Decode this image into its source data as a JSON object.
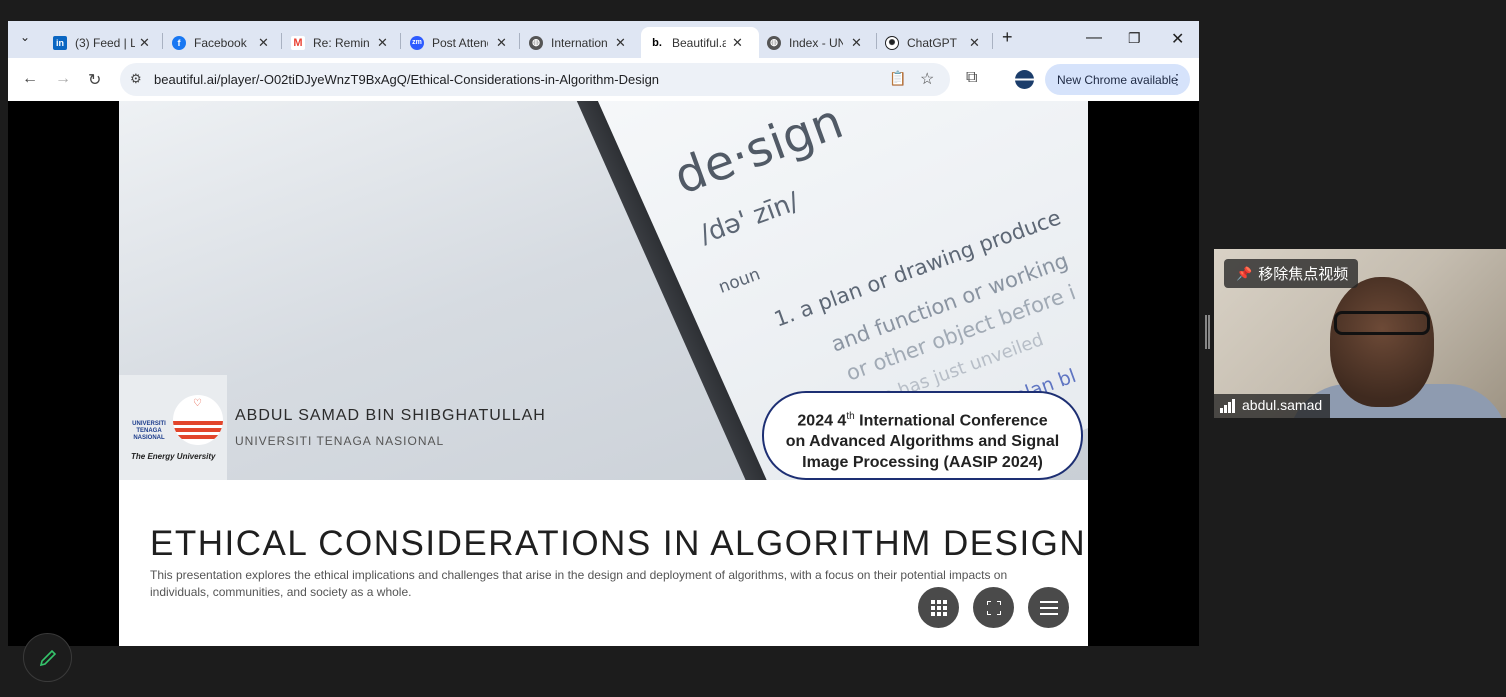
{
  "browser": {
    "tabs": [
      {
        "title": "(3) Feed | L",
        "icon": "linkedin-icon",
        "color": "#0a66c2"
      },
      {
        "title": "Facebook",
        "icon": "facebook-icon",
        "color": "#1877f2"
      },
      {
        "title": "Re: Remind",
        "icon": "gmail-icon",
        "color": "#ea4335"
      },
      {
        "title": "Post Attend",
        "icon": "zoom-icon",
        "color": "#2d5bff"
      },
      {
        "title": "Internation",
        "icon": "globe-icon",
        "color": "#444444"
      },
      {
        "title": "Beautiful.ai",
        "icon": "beautifulai-icon",
        "color": "#000000"
      },
      {
        "title": "Index - UN",
        "icon": "globe-icon",
        "color": "#444444"
      },
      {
        "title": "ChatGPT",
        "icon": "chatgpt-icon",
        "color": "#202123"
      }
    ],
    "active_tab": 5,
    "url": "beautiful.ai/player/-O02tiDJyeWnzT9BxAgQ/Ethical-Considerations-in-Algorithm-Design",
    "update_button": "New Chrome available"
  },
  "slide": {
    "dictionary": {
      "word": "de·sign",
      "pronunciation": "/də' zīn/",
      "pos": "noun",
      "line1": "1.  a plan or drawing produce",
      "line2": "and function or working",
      "line3": "or other object before i",
      "line4": "\"he has just unveiled",
      "line5": "plan bl"
    },
    "university_logo_text": "UNIVERSITI TENAGA NASIONAL",
    "university_tagline": "The Energy University",
    "author": "ABDUL SAMAD BIN SHIBGHATULLAH",
    "affiliation": "UNIVERSITI TENAGA NASIONAL",
    "conference": {
      "line1_prefix": "2024 4",
      "line1_sup": "th",
      "line1_suffix": " International Conference",
      "line2": "on Advanced Algorithms and Signal",
      "line3": "Image Processing (AASIP 2024)"
    },
    "title": "ETHICAL CONSIDERATIONS IN ALGORITHM DESIGN",
    "description": "This presentation explores the ethical implications and challenges that arise in the design and deployment of algorithms, with a focus on their potential impacts on individuals, communities, and society as a whole."
  },
  "meeting": {
    "unpin_label": "移除焦点视频",
    "participant_name": "abdul.samad"
  }
}
